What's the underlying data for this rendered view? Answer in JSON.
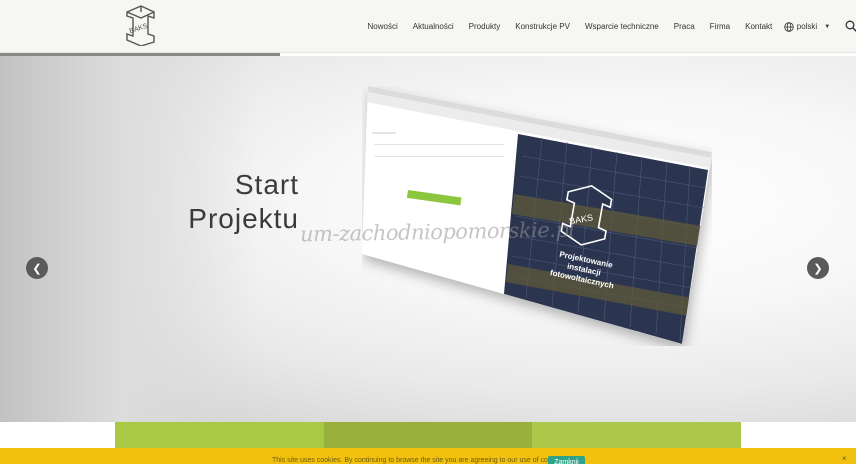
{
  "brand": {
    "logo_text": "BAKS"
  },
  "nav": {
    "items": [
      "Nowości",
      "Aktualności",
      "Produkty",
      "Konstrukcje PV",
      "Wsparcie techniczne",
      "Praca",
      "Firma",
      "Kontakt"
    ],
    "language": "polski"
  },
  "hero": {
    "headline_line1": "Start",
    "headline_line2": "Projektu",
    "watermark": "um-zachodniopomorskie.pl",
    "slide_text_line1": "Projektowanie",
    "slide_text_line2": "instalacji",
    "slide_text_line3": "fotowoltaicznych",
    "slide_logo_text": "BAKS"
  },
  "cookie": {
    "text": "This site uses cookies. By continuing to browse the site you are agreeing to our use of cookies.",
    "accept_label": "Zamknij",
    "close_label": "×"
  },
  "colors": {
    "accent_green": "#a9c844",
    "cookie_yellow": "#f2c10f",
    "button_teal": "#2ea38a"
  }
}
